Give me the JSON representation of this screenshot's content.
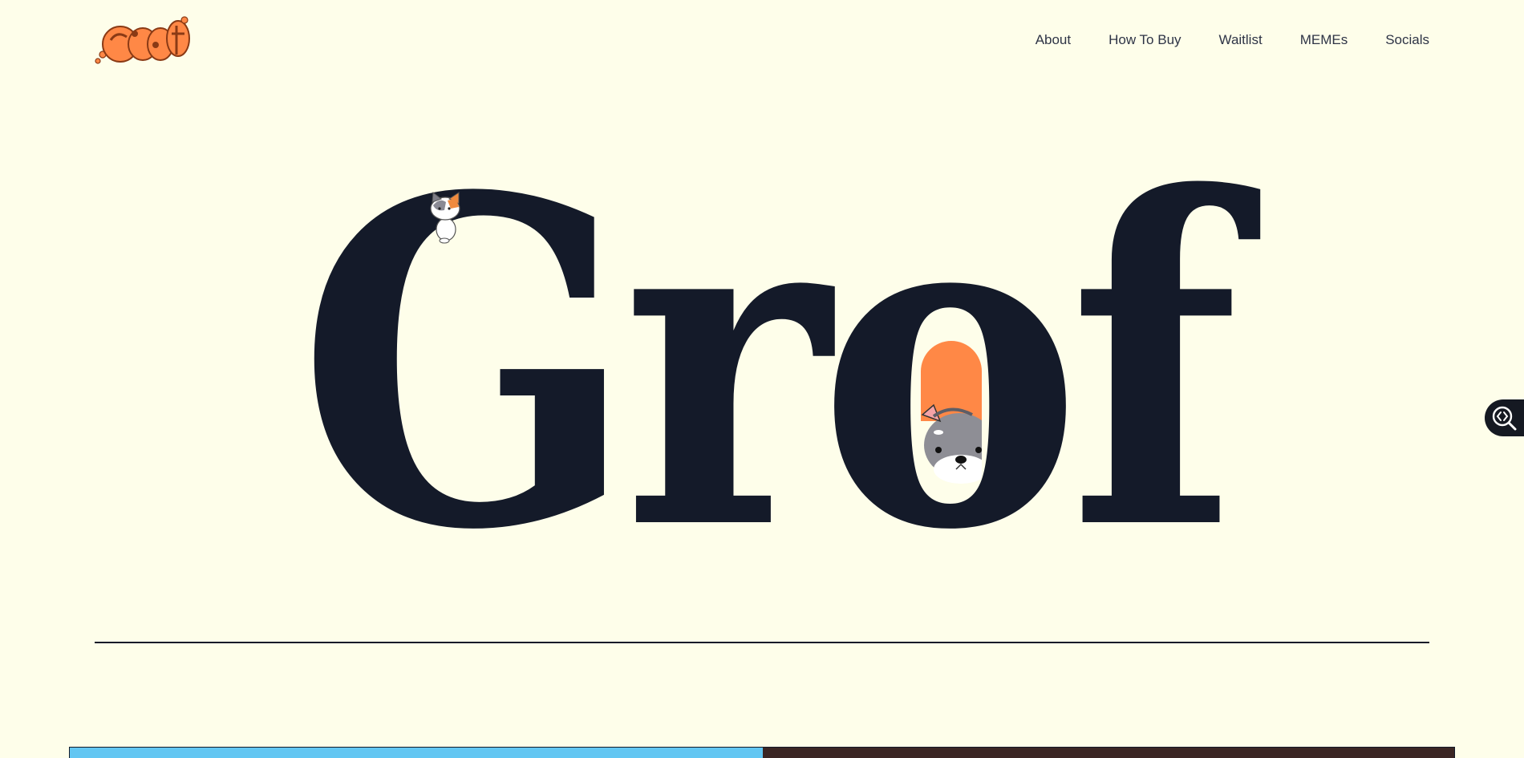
{
  "header": {
    "logo_text": "GROF",
    "nav": [
      {
        "label": "About"
      },
      {
        "label": "How To Buy"
      },
      {
        "label": "Waitlist"
      },
      {
        "label": "MEMEs"
      },
      {
        "label": "Socials"
      }
    ]
  },
  "hero": {
    "title": "Grof"
  },
  "colors": {
    "background": "#FEFEEA",
    "text_dark": "#141A29",
    "brand_orange": "#FF8846",
    "strip_blue": "#62C6F2"
  },
  "icons": {
    "floating_tool": "code-search-icon"
  }
}
